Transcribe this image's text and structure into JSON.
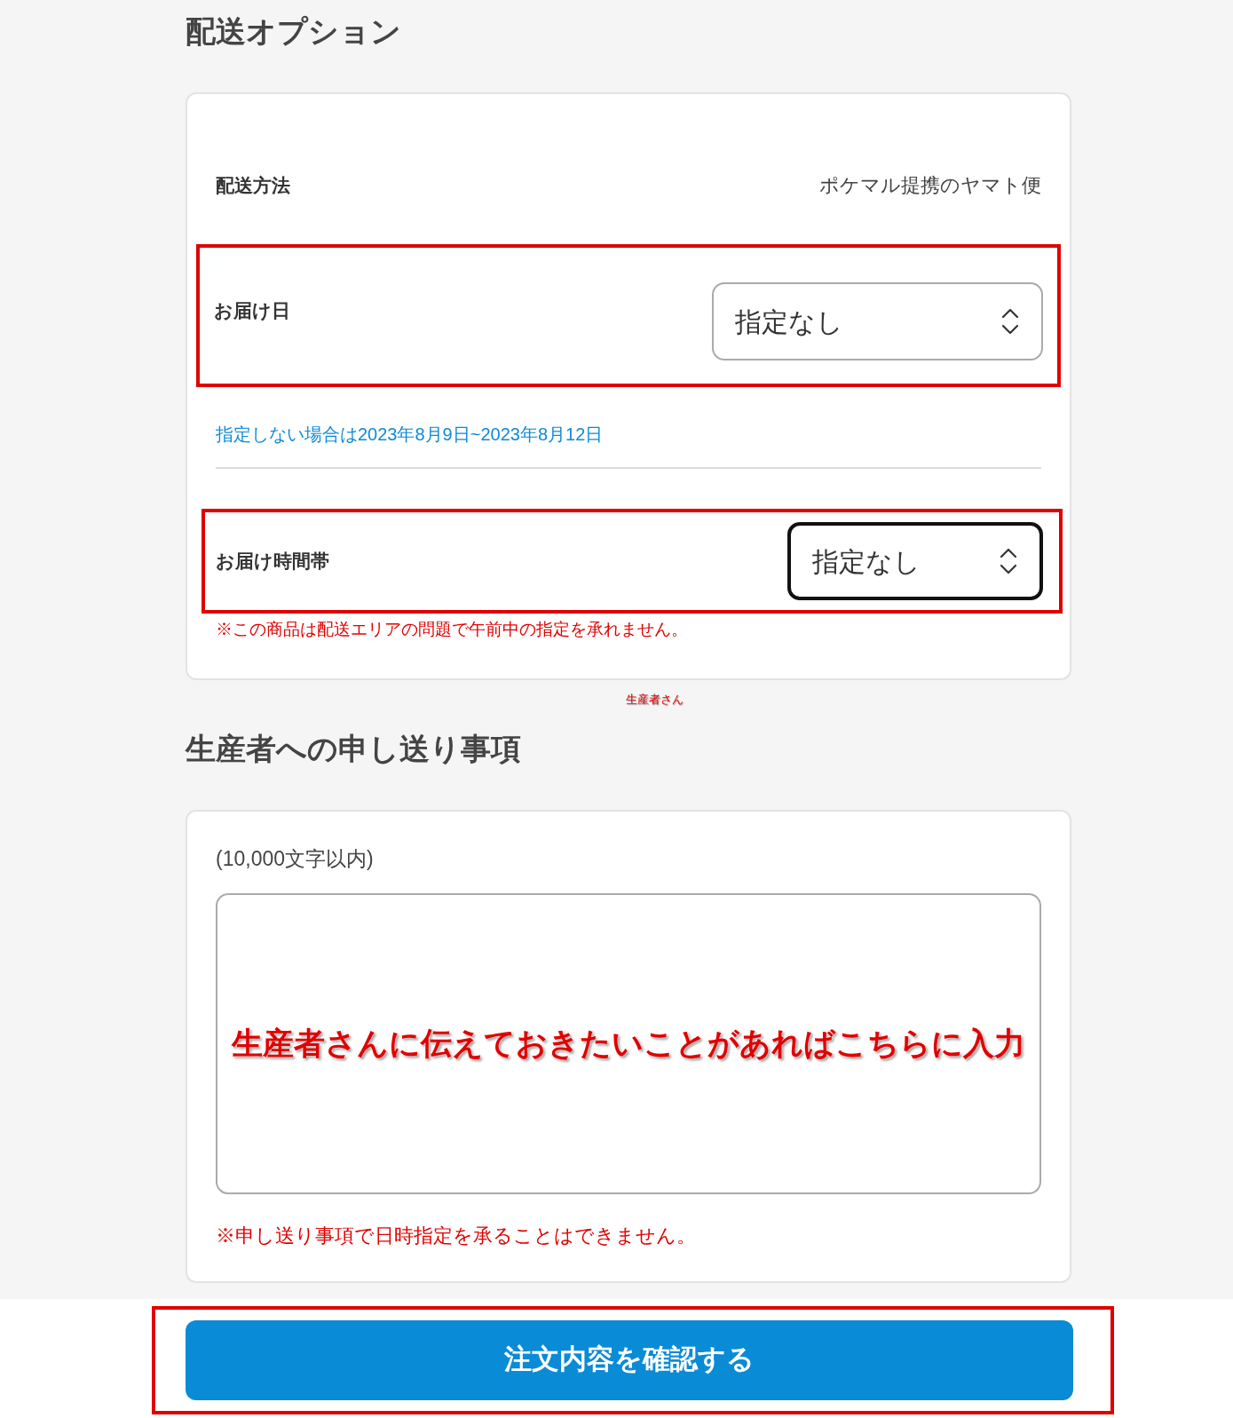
{
  "delivery_options": {
    "title": "配送オプション",
    "method": {
      "label": "配送方法",
      "value": "ポケマル提携のヤマト便"
    },
    "date": {
      "label": "お届け日",
      "value": "指定なし",
      "highlighted": true,
      "focused": false
    },
    "date_hint": "指定しない場合は2023年8月9日~2023年8月12日",
    "time_slot": {
      "label": "お届け時間帯",
      "value": "指定なし",
      "highlighted": true,
      "focused": true
    },
    "time_note": "※この商品は配送エリアの問題で午前中の指定を承れません。"
  },
  "caption": "生産者さん",
  "message": {
    "title": "生産者への申し送り事項",
    "limit": "(10,000文字以内)",
    "annotation": "生産者さんに伝えておきたいことがあればこちらに入力",
    "note": "※申し送り事項で日時指定を承ることはできません。"
  },
  "submit": {
    "label": "注文内容を確認する",
    "highlighted": true
  }
}
